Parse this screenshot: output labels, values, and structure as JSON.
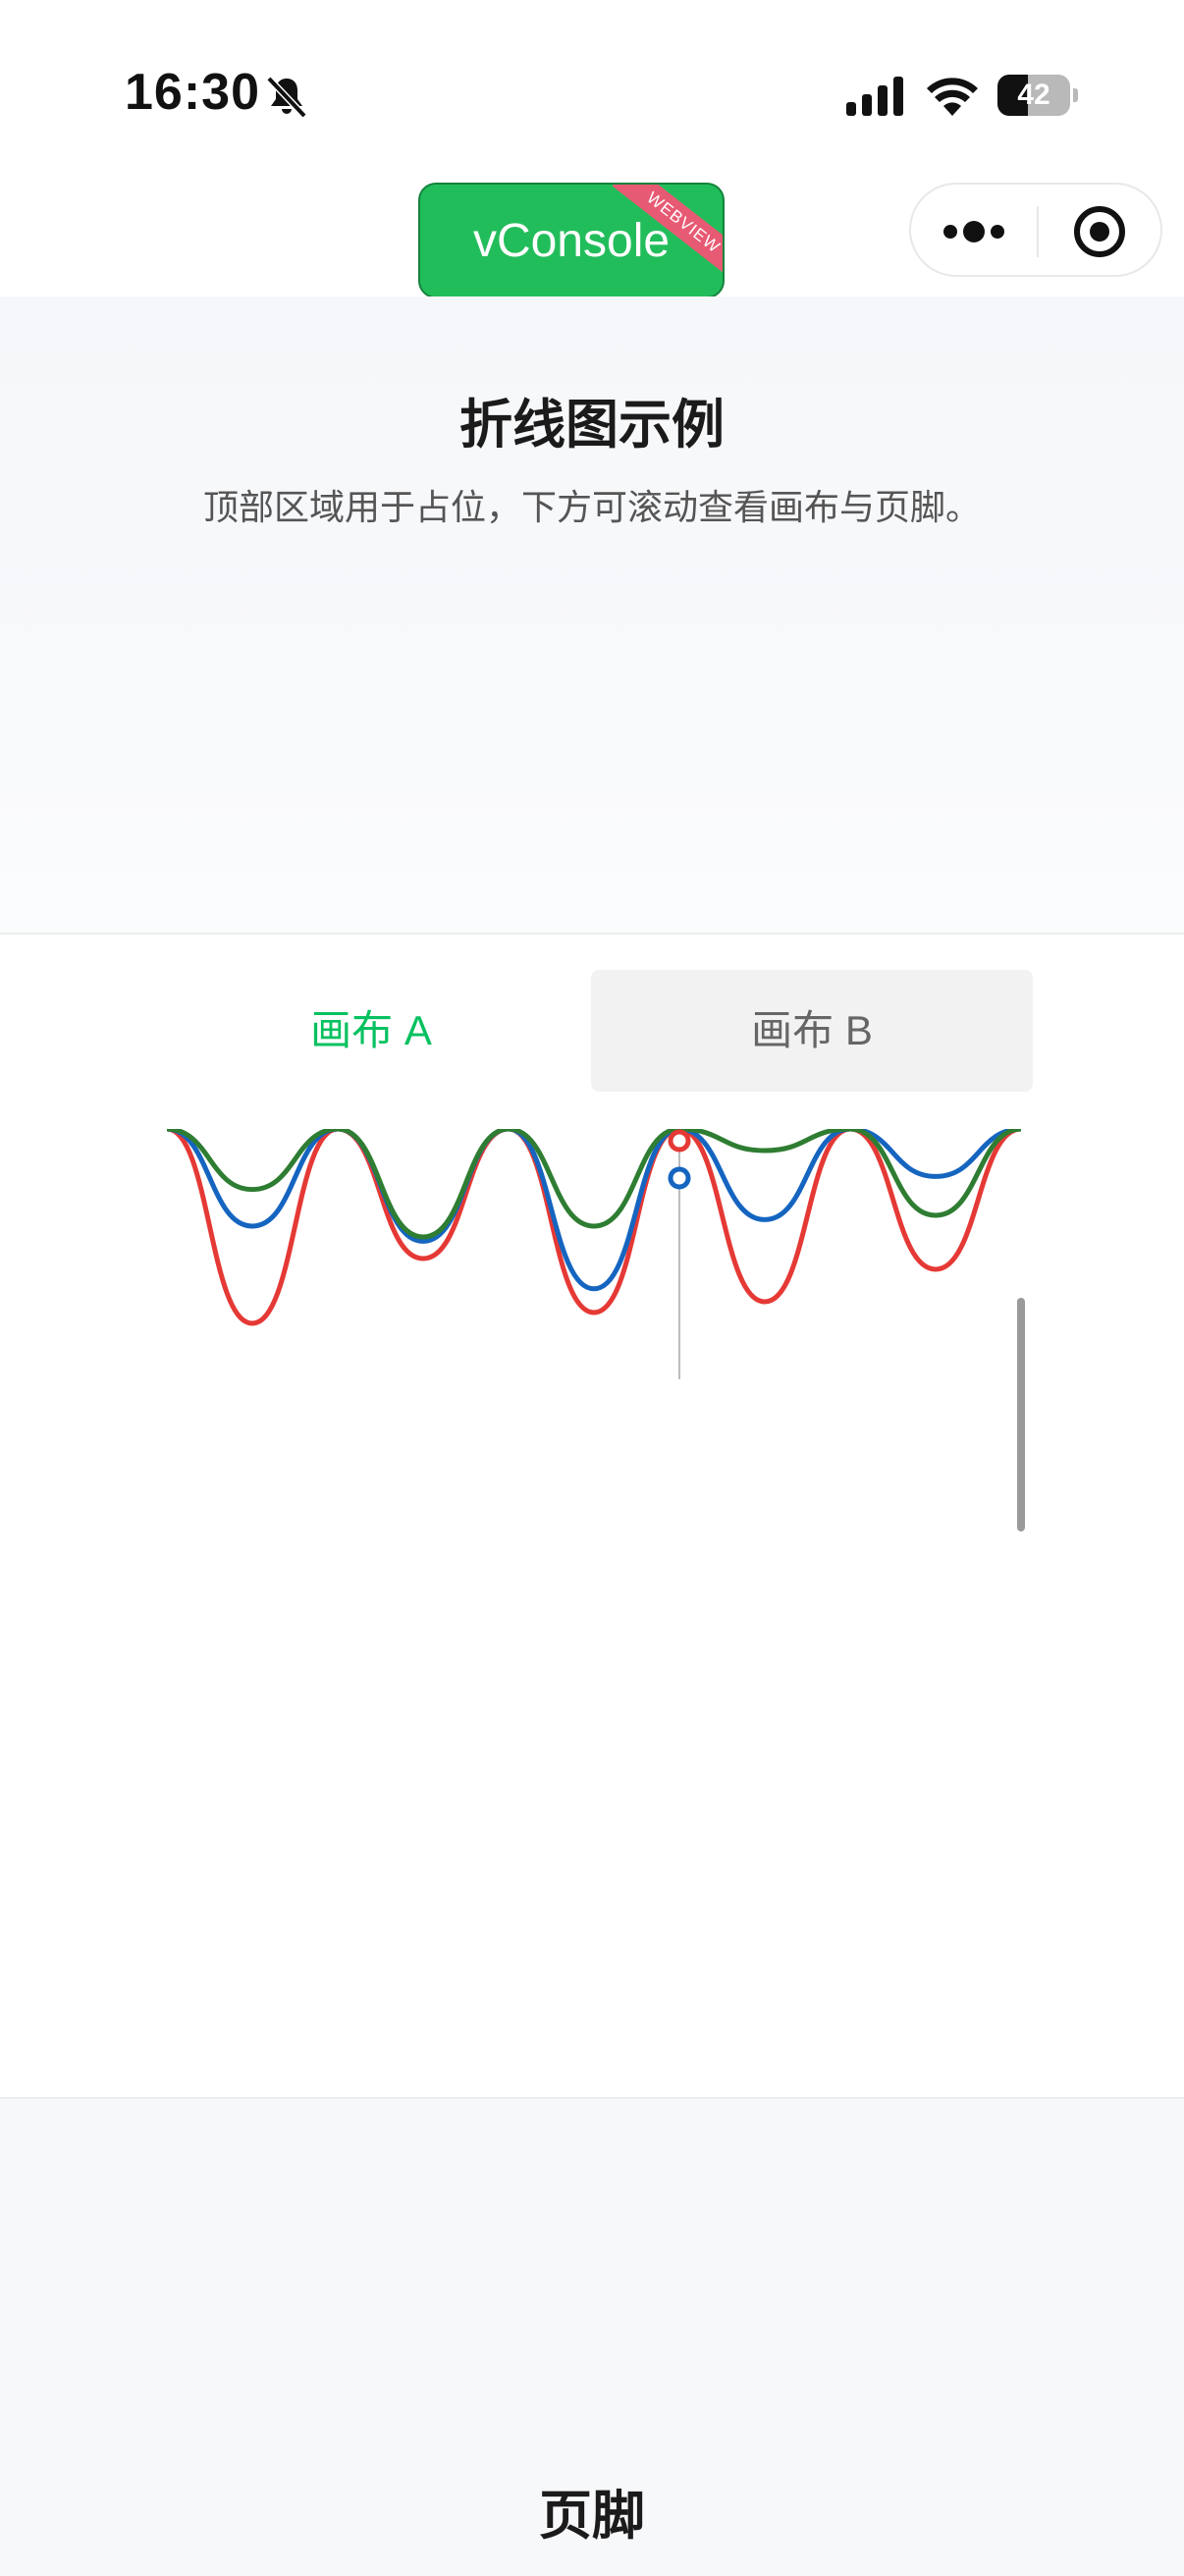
{
  "status_bar": {
    "time": "16:30",
    "battery": "42",
    "battery_level": 0.42
  },
  "vconsole": {
    "label": "vConsole",
    "ribbon": "WEBVIEW"
  },
  "header": {
    "title": "折线图示例",
    "subtitle": "顶部区域用于占位，下方可滚动查看画布与页脚。"
  },
  "tabs": [
    {
      "label": "画布 A",
      "active": true
    },
    {
      "label": "画布 B",
      "active": false
    }
  ],
  "chart_data": {
    "type": "line",
    "title": "",
    "xlabel": "",
    "ylabel": "",
    "series_colors": [
      "#e53935",
      "#1565c0",
      "#2e7d32"
    ],
    "series": [
      {
        "values": [
          0,
          0.9,
          0,
          0.6,
          0,
          0.85,
          0,
          0.8,
          0,
          0.65,
          0
        ]
      },
      {
        "values": [
          0,
          0.45,
          0,
          0.52,
          0,
          0.74,
          0,
          0.42,
          0,
          0.22,
          0
        ]
      },
      {
        "values": [
          0,
          0.28,
          0,
          0.5,
          0,
          0.45,
          0,
          0.1,
          0,
          0.4,
          0
        ]
      }
    ]
  },
  "footer": {
    "label": "页脚"
  },
  "colors": {
    "accent": "#07c160",
    "vconsole_green": "#22bd5b",
    "ribbon_pink": "#e75a73"
  }
}
